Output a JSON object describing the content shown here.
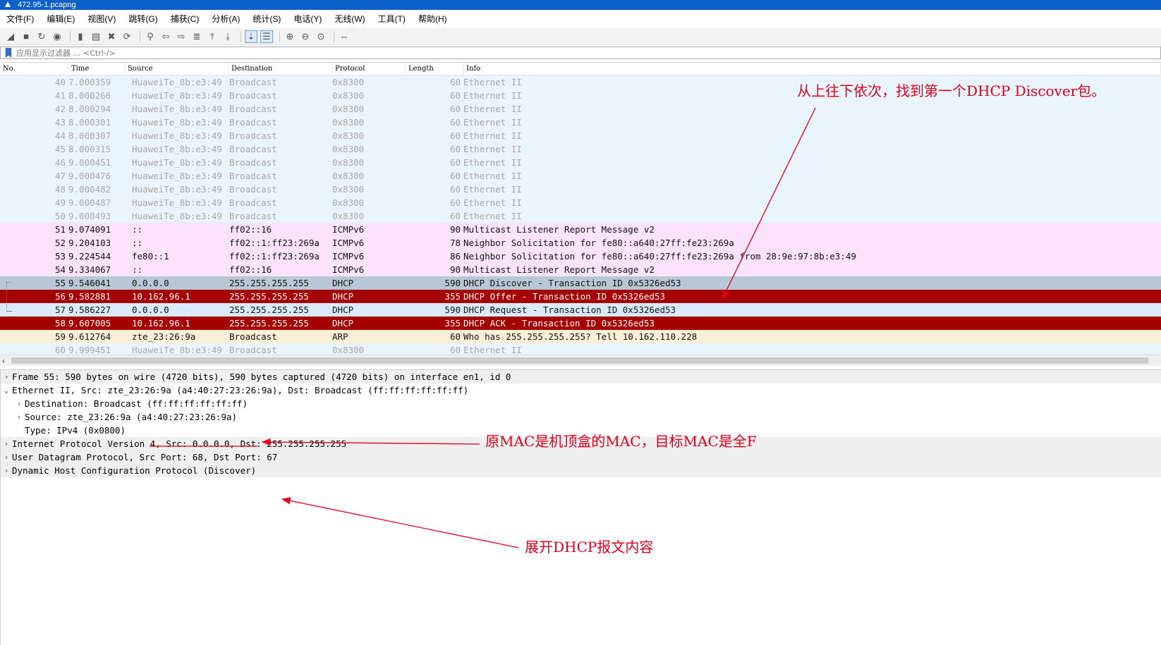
{
  "window": {
    "title": "472.95-1.pcapng"
  },
  "menu": [
    "文件(F)",
    "编辑(E)",
    "视图(V)",
    "跳转(G)",
    "捕获(C)",
    "分析(A)",
    "统计(S)",
    "电话(Y)",
    "无线(W)",
    "工具(T)",
    "帮助(H)"
  ],
  "toolbar_icons": [
    "shark-fin-start-icon",
    "stop-icon",
    "restart-icon",
    "capture-options-icon",
    "open-file-icon",
    "save-icon",
    "close-file-icon",
    "reload-icon",
    "find-icon",
    "back-icon",
    "forward-icon",
    "goto-packet-icon",
    "first-packet-icon",
    "last-packet-icon",
    "autoscroll-icon",
    "colorize-icon",
    "zoom-in-icon",
    "zoom-out-icon",
    "zoom-reset-icon",
    "resize-columns-icon"
  ],
  "filter": {
    "placeholder": "应用显示过滤器 … <Ctrl-/>"
  },
  "columns": [
    "No.",
    "Time",
    "Source",
    "Destination",
    "Protocol",
    "Length",
    "Info"
  ],
  "packets": [
    {
      "no": "40",
      "time": "7.000359",
      "src": "HuaweiTe_8b:e3:49",
      "dst": "Broadcast",
      "proto": "0x8300",
      "len": "60",
      "info": "Ethernet II",
      "style": "eth"
    },
    {
      "no": "41",
      "time": "8.000266",
      "src": "HuaweiTe_8b:e3:49",
      "dst": "Broadcast",
      "proto": "0x8300",
      "len": "60",
      "info": "Ethernet II",
      "style": "eth"
    },
    {
      "no": "42",
      "time": "8.000294",
      "src": "HuaweiTe_8b:e3:49",
      "dst": "Broadcast",
      "proto": "0x8300",
      "len": "60",
      "info": "Ethernet II",
      "style": "eth"
    },
    {
      "no": "43",
      "time": "8.000301",
      "src": "HuaweiTe_8b:e3:49",
      "dst": "Broadcast",
      "proto": "0x8300",
      "len": "60",
      "info": "Ethernet II",
      "style": "eth"
    },
    {
      "no": "44",
      "time": "8.000307",
      "src": "HuaweiTe_8b:e3:49",
      "dst": "Broadcast",
      "proto": "0x8300",
      "len": "60",
      "info": "Ethernet II",
      "style": "eth"
    },
    {
      "no": "45",
      "time": "8.000315",
      "src": "HuaweiTe_8b:e3:49",
      "dst": "Broadcast",
      "proto": "0x8300",
      "len": "60",
      "info": "Ethernet II",
      "style": "eth"
    },
    {
      "no": "46",
      "time": "9.000451",
      "src": "HuaweiTe_8b:e3:49",
      "dst": "Broadcast",
      "proto": "0x8300",
      "len": "60",
      "info": "Ethernet II",
      "style": "eth"
    },
    {
      "no": "47",
      "time": "9.000476",
      "src": "HuaweiTe_8b:e3:49",
      "dst": "Broadcast",
      "proto": "0x8300",
      "len": "60",
      "info": "Ethernet II",
      "style": "eth"
    },
    {
      "no": "48",
      "time": "9.000482",
      "src": "HuaweiTe_8b:e3:49",
      "dst": "Broadcast",
      "proto": "0x8300",
      "len": "60",
      "info": "Ethernet II",
      "style": "eth"
    },
    {
      "no": "49",
      "time": "9.000487",
      "src": "HuaweiTe_8b:e3:49",
      "dst": "Broadcast",
      "proto": "0x8300",
      "len": "60",
      "info": "Ethernet II",
      "style": "eth"
    },
    {
      "no": "50",
      "time": "9.000493",
      "src": "HuaweiTe_8b:e3:49",
      "dst": "Broadcast",
      "proto": "0x8300",
      "len": "60",
      "info": "Ethernet II",
      "style": "eth"
    },
    {
      "no": "51",
      "time": "9.074091",
      "src": "::",
      "dst": "ff02::16",
      "proto": "ICMPv6",
      "len": "90",
      "info": "Multicast Listener Report Message v2",
      "style": "ipv6"
    },
    {
      "no": "52",
      "time": "9.204103",
      "src": "::",
      "dst": "ff02::1:ff23:269a",
      "proto": "ICMPv6",
      "len": "78",
      "info": "Neighbor Solicitation for fe80::a640:27ff:fe23:269a",
      "style": "ipv6"
    },
    {
      "no": "53",
      "time": "9.224544",
      "src": "fe80::1",
      "dst": "ff02::1:ff23:269a",
      "proto": "ICMPv6",
      "len": "86",
      "info": "Neighbor Solicitation for fe80::a640:27ff:fe23:269a from 28:9e:97:8b:e3:49",
      "style": "ipv6"
    },
    {
      "no": "54",
      "time": "9.334067",
      "src": "::",
      "dst": "ff02::16",
      "proto": "ICMPv6",
      "len": "90",
      "info": "Multicast Listener Report Message v2",
      "style": "ipv6"
    },
    {
      "no": "55",
      "time": "9.546041",
      "src": "0.0.0.0",
      "dst": "255.255.255.255",
      "proto": "DHCP",
      "len": "590",
      "info": "DHCP Discover - Transaction ID 0x5326ed53",
      "style": "sel"
    },
    {
      "no": "56",
      "time": "9.582881",
      "src": "10.162.96.1",
      "dst": "255.255.255.255",
      "proto": "DHCP",
      "len": "355",
      "info": "DHCP Offer    - Transaction ID 0x5326ed53",
      "style": "red"
    },
    {
      "no": "57",
      "time": "9.586227",
      "src": "0.0.0.0",
      "dst": "255.255.255.255",
      "proto": "DHCP",
      "len": "590",
      "info": "DHCP Request  - Transaction ID 0x5326ed53",
      "style": "dhcp"
    },
    {
      "no": "58",
      "time": "9.607005",
      "src": "10.162.96.1",
      "dst": "255.255.255.255",
      "proto": "DHCP",
      "len": "355",
      "info": "DHCP ACK      - Transaction ID 0x5326ed53",
      "style": "red"
    },
    {
      "no": "59",
      "time": "9.612764",
      "src": "zte_23:26:9a",
      "dst": "Broadcast",
      "proto": "ARP",
      "len": "60",
      "info": "Who has 255.255.255.255? Tell 10.162.110.228",
      "style": "arp"
    },
    {
      "no": "60",
      "time": "9.999451",
      "src": "HuaweiTe_8b:e3:49",
      "dst": "Broadcast",
      "proto": "0x8300",
      "len": "60",
      "info": "Ethernet II",
      "style": "eth"
    }
  ],
  "details": [
    {
      "text": "Frame 55: 590 bytes on wire (4720 bits), 590 bytes captured (4720 bits) on interface en1, id 0",
      "level": 0,
      "toggle": "collapsed",
      "shade": true
    },
    {
      "text": "Ethernet II, Src: zte_23:26:9a (a4:40:27:23:26:9a), Dst: Broadcast (ff:ff:ff:ff:ff:ff)",
      "level": 0,
      "toggle": "expanded",
      "shade": false
    },
    {
      "text": "Destination: Broadcast (ff:ff:ff:ff:ff:ff)",
      "level": 1,
      "toggle": "collapsed",
      "shade": false
    },
    {
      "text": "Source: zte_23:26:9a (a4:40:27:23:26:9a)",
      "level": 1,
      "toggle": "collapsed",
      "shade": false
    },
    {
      "text": "Type: IPv4 (0x0800)",
      "level": 1,
      "toggle": "none",
      "shade": false
    },
    {
      "text": "Internet Protocol Version 4, Src: 0.0.0.0, Dst: 255.255.255.255",
      "level": 0,
      "toggle": "collapsed",
      "shade": true
    },
    {
      "text": "User Datagram Protocol, Src Port: 68, Dst Port: 67",
      "level": 0,
      "toggle": "collapsed",
      "shade": true
    },
    {
      "text": "Dynamic Host Configuration Protocol (Discover)",
      "level": 0,
      "toggle": "collapsed",
      "shade": true
    }
  ],
  "annotations": {
    "top": "从上往下依次，找到第一个DHCP Discover包。",
    "mac": "原MAC是机顶盒的MAC，目标MAC是全F",
    "dhcp": "展开DHCP报文内容"
  },
  "colors": {
    "eth_row": "#eaf4fc",
    "ipv6_row": "#fbe3fb",
    "selected_row": "#b7c7d6",
    "dhcp_offer_ack_row": "#a40000",
    "dhcp_request_row": "#d9ebf8",
    "arp_row": "#faf0d7",
    "annotation_red": "#e0001b"
  }
}
